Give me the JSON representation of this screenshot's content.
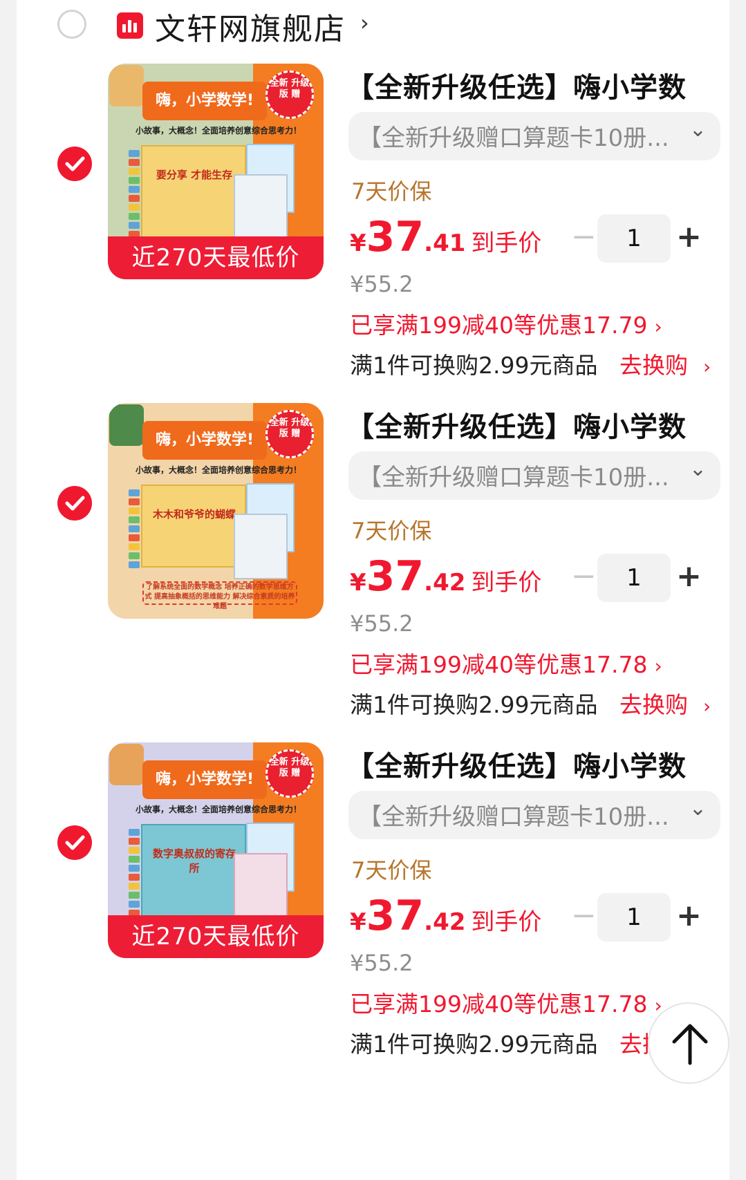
{
  "shop": {
    "name": "文轩网旗舰店",
    "chevron": "›",
    "icon": "shop-bar-chart-icon",
    "brand_color": "#f0182f"
  },
  "items": [
    {
      "title": "【全新升级任选】嗨小学数",
      "variant": "【全新升级赠口算题卡10册...",
      "guarantee": "7天价保",
      "price_currency": "¥",
      "price_int": "37",
      "price_dec": ".41",
      "price_label": "到手价",
      "quantity": "1",
      "original_price": "¥55.2",
      "promo": "已享满199减40等优惠17.79",
      "exchange_text": "满1件可换购2.99元商品",
      "exchange_link": "去换购",
      "thumb_banner": "嗨，小学数学!",
      "thumb_seal": "全新 升级版 赠",
      "thumb_tagline": "小故事，大概念！全面培养创意综合思考力！",
      "thumb_book_title": "要分享 才能生存",
      "thumb_badge": "近270天最低价",
      "thumb_left_color": "#c9d6b1"
    },
    {
      "title": "【全新升级任选】嗨小学数",
      "variant": "【全新升级赠口算题卡10册...",
      "guarantee": "7天价保",
      "price_currency": "¥",
      "price_int": "37",
      "price_dec": ".42",
      "price_label": "到手价",
      "quantity": "1",
      "original_price": "¥55.2",
      "promo": "已享满199减40等优惠17.78",
      "exchange_text": "满1件可换购2.99元商品",
      "exchange_link": "去换购",
      "thumb_banner": "嗨，小学数学!",
      "thumb_seal": "全新 升级版 赠",
      "thumb_tagline": "小故事，大概念！全面培养创意综合思考力！",
      "thumb_book_title": "木木和爷爷的蝴蝶",
      "thumb_note": "了解系统全面的数学概念 培养正确的数学思维方式 提高抽象概括的思维能力 解决综合素质的培养难题",
      "thumb_left_color": "#f2d5a8"
    },
    {
      "title": "【全新升级任选】嗨小学数",
      "variant": "【全新升级赠口算题卡10册...",
      "guarantee": "7天价保",
      "price_currency": "¥",
      "price_int": "37",
      "price_dec": ".42",
      "price_label": "到手价",
      "quantity": "1",
      "original_price": "¥55.2",
      "promo": "已享满199减40等优惠17.78",
      "exchange_text": "满1件可换购2.99元商品",
      "exchange_link": "去换购",
      "thumb_banner": "嗨，小学数学!",
      "thumb_seal": "全新 升级版 赠",
      "thumb_tagline": "小故事，大概念！全面培养创意综合思考力！",
      "thumb_book_title": "数字奥叔叔的寄存所",
      "thumb_badge": "近270天最低价",
      "thumb_left_color": "#d4d2ea"
    }
  ],
  "icons": {
    "check": "check-icon",
    "variant_chevron": "chevron-down-icon",
    "promo_chevron": "chevron-right-icon",
    "back_to_top": "arrow-up-icon"
  },
  "colors": {
    "accent": "#f0182f",
    "guarantee": "#b7752d",
    "muted": "#8d8d8d"
  }
}
